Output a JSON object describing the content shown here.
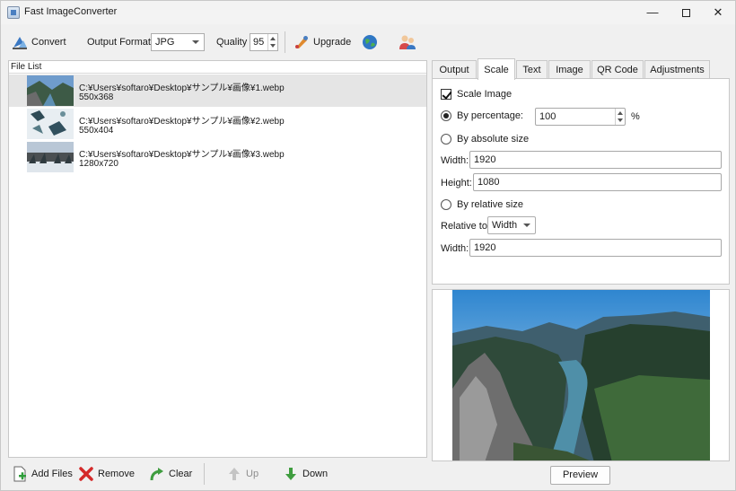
{
  "window": {
    "title": "Fast ImageConverter",
    "minimize": "—",
    "close": "✕"
  },
  "toolbar": {
    "convert_label": "Convert",
    "output_format_label": "Output Format:",
    "output_format_value": "JPG",
    "quality_label": "Quality",
    "quality_value": "95",
    "upgrade_label": "Upgrade"
  },
  "file_list": {
    "header": "File List",
    "files": [
      {
        "path": "C:¥Users¥softaro¥Desktop¥サンプル¥画像¥1.webp",
        "size": "550x368"
      },
      {
        "path": "C:¥Users¥softaro¥Desktop¥サンプル¥画像¥2.webp",
        "size": "550x404"
      },
      {
        "path": "C:¥Users¥softaro¥Desktop¥サンプル¥画像¥3.webp",
        "size": "1280x720"
      }
    ]
  },
  "actions": {
    "add_files": "Add Files",
    "remove": "Remove",
    "clear": "Clear",
    "up": "Up",
    "down": "Down"
  },
  "tabs": [
    "Output",
    "Scale",
    "Text",
    "Image",
    "QR Code",
    "Adjustments"
  ],
  "scale": {
    "scale_image_label": "Scale Image",
    "by_percentage_label": "By percentage:",
    "percentage_value": "100",
    "percent_sign": "%",
    "by_absolute_label": "By absolute size",
    "width_label": "Width:",
    "width_value": "1920",
    "height_label": "Height:",
    "height_value": "1080",
    "by_relative_label": "By relative size",
    "relative_to_label": "Relative to:",
    "relative_to_value": "Width",
    "relative_width_label": "Width:",
    "relative_width_value": "1920"
  },
  "preview": {
    "button_label": "Preview"
  }
}
